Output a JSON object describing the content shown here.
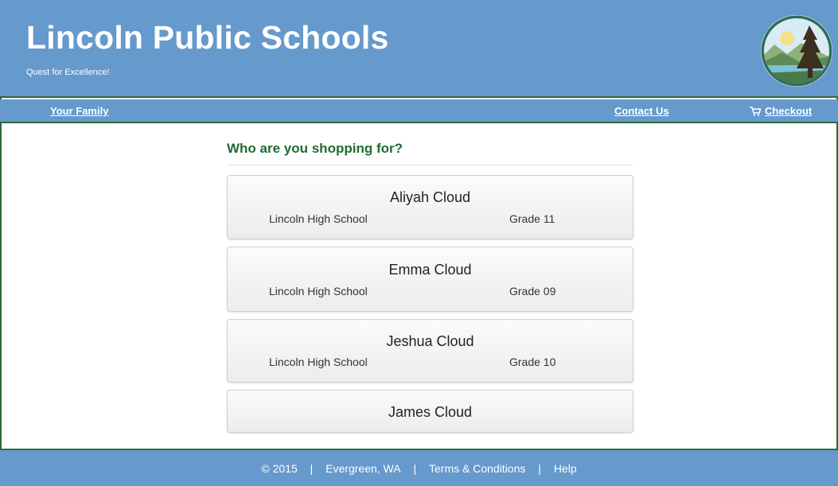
{
  "header": {
    "title": "Lincoln Public Schools",
    "tagline": "Quest for Excellence!",
    "logo_icon": "landscape-tree-logo"
  },
  "nav": {
    "your_family": "Your Family",
    "contact_us": "Contact Us",
    "checkout": "Checkout",
    "checkout_icon": "cart-icon"
  },
  "main": {
    "heading": "Who are you shopping for?",
    "students": [
      {
        "name": "Aliyah Cloud",
        "school": "Lincoln High School",
        "grade": "Grade 11"
      },
      {
        "name": "Emma Cloud",
        "school": "Lincoln High School",
        "grade": "Grade 09"
      },
      {
        "name": "Jeshua Cloud",
        "school": "Lincoln High School",
        "grade": "Grade 10"
      },
      {
        "name": "James Cloud"
      }
    ]
  },
  "footer": {
    "copyright": "© 2015",
    "location": "Evergreen, WA",
    "terms": "Terms & Conditions",
    "help": "Help",
    "separator": "|"
  },
  "colors": {
    "brand_blue": "#6699cc",
    "border_green": "#2c6b3a",
    "heading_green": "#1f6b33"
  }
}
